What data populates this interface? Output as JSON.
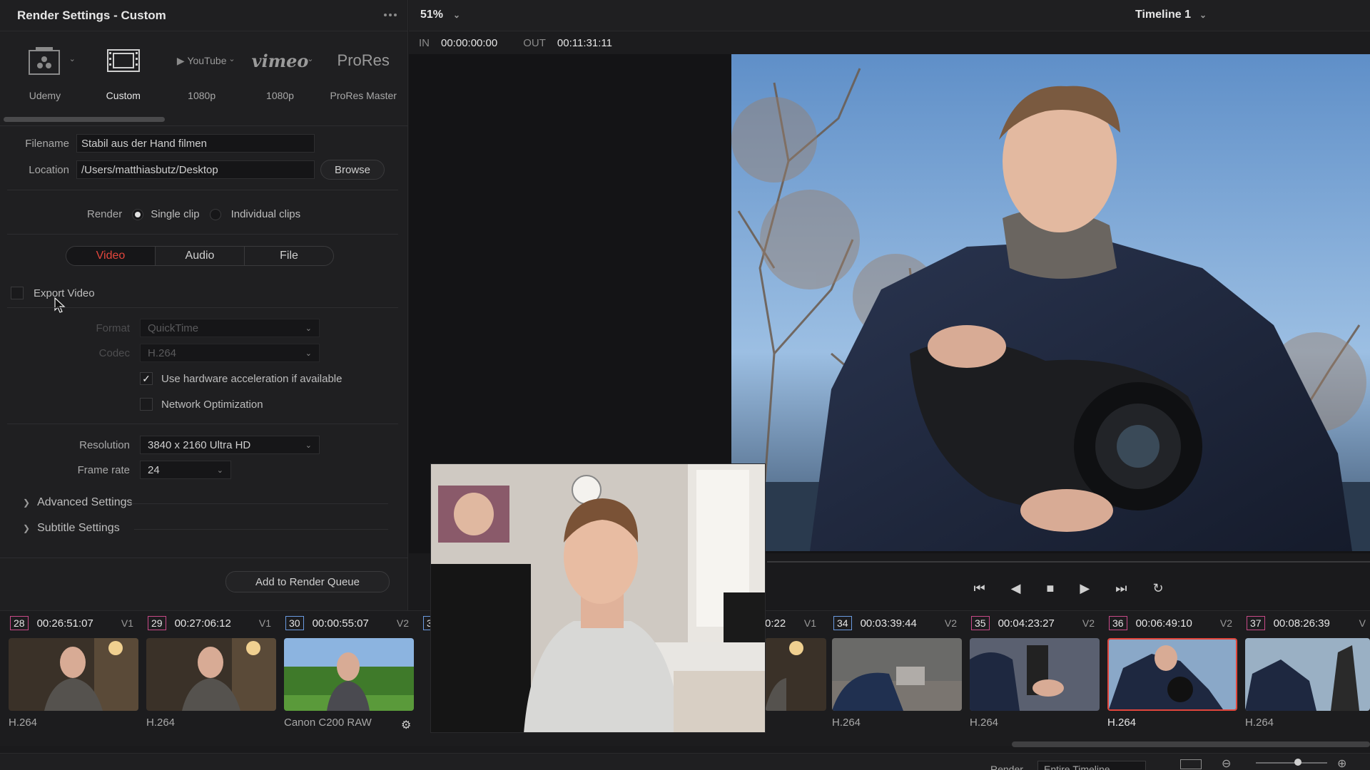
{
  "panel": {
    "title": "Render Settings - Custom",
    "presets": [
      {
        "name": "udemy",
        "label": "Udemy"
      },
      {
        "name": "custom",
        "label": "Custom"
      },
      {
        "name": "youtube",
        "logo": "YouTube",
        "label": "1080p"
      },
      {
        "name": "vimeo",
        "logo": "vimeo",
        "label": "1080p"
      },
      {
        "name": "prores",
        "logo": "ProRes",
        "label": "ProRes Master"
      }
    ],
    "filename_label": "Filename",
    "filename_value": "Stabil aus der Hand filmen",
    "location_label": "Location",
    "location_value": "/Users/matthiasbutz/Desktop",
    "browse": "Browse",
    "render_label": "Render",
    "single_clip": "Single clip",
    "individual_clips": "Individual clips",
    "tabs": [
      "Video",
      "Audio",
      "File"
    ],
    "export_video": "Export Video",
    "format_label": "Format",
    "format_value": "QuickTime",
    "codec_label": "Codec",
    "codec_value": "H.264",
    "hw_accel": "Use hardware acceleration if available",
    "network_opt": "Network Optimization",
    "resolution_label": "Resolution",
    "resolution_value": "3840 x 2160 Ultra HD",
    "framerate_label": "Frame rate",
    "framerate_value": "24",
    "advanced": "Advanced Settings",
    "subtitle": "Subtitle Settings",
    "add_queue": "Add to Render Queue"
  },
  "viewer": {
    "zoom": "51%",
    "timeline": "Timeline 1",
    "in_label": "IN",
    "in_tc": "00:00:00:00",
    "out_label": "OUT",
    "out_tc": "00:11:31:11"
  },
  "clips": [
    {
      "num": "28",
      "tc": "00:26:51:07",
      "track": "V1",
      "codec": "H.264"
    },
    {
      "num": "29",
      "tc": "00:27:06:12",
      "track": "V1",
      "codec": "H.264"
    },
    {
      "num": "30",
      "tc": "00:00:55:07",
      "track": "V2",
      "codec": "Canon C200 RAW"
    },
    {
      "num": "3",
      "tc": "",
      "track": "",
      "codec": ""
    },
    {
      "num": "",
      "tc": "0:22",
      "track": "V1",
      "codec": ""
    },
    {
      "num": "34",
      "tc": "00:03:39:44",
      "track": "V2",
      "codec": "H.264"
    },
    {
      "num": "35",
      "tc": "00:04:23:27",
      "track": "V2",
      "codec": "H.264"
    },
    {
      "num": "36",
      "tc": "00:06:49:10",
      "track": "V2",
      "codec": "H.264"
    },
    {
      "num": "37",
      "tc": "00:08:26:39",
      "track": "V",
      "codec": "H.264"
    }
  ],
  "bottom": {
    "render_label": "Render",
    "render_value": "Entire Timeline"
  },
  "colors": {
    "accent_red": "#e2463c",
    "clip_pink": "#c84a88",
    "clip_blue": "#6a9ae0"
  }
}
